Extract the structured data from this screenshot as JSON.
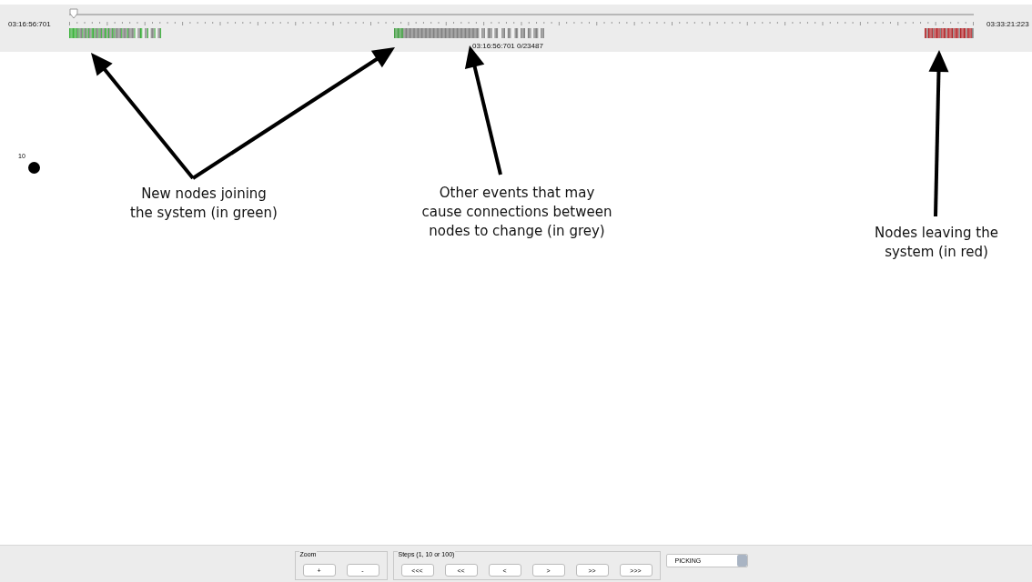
{
  "timeline": {
    "start_time": "03:16:56:701",
    "end_time": "03:33:21:223",
    "level": 0,
    "position_label": "03:16:56:701 0/23487"
  },
  "graph": {
    "nodes": [
      {
        "label": "10"
      }
    ]
  },
  "annotations": [
    {
      "lines": [
        "New nodes joining",
        "the system (in green)"
      ]
    },
    {
      "lines": [
        "Other events that may",
        "cause connections between",
        "nodes to change (in grey)"
      ]
    },
    {
      "lines": [
        "Nodes leaving the",
        "system (in red)"
      ]
    }
  ],
  "toolbar": {
    "zoom": {
      "title": "Zoom",
      "buttons": [
        "+",
        "-"
      ]
    },
    "steps": {
      "title": "Steps (1, 10 or 100)",
      "buttons": [
        "<<<",
        "<<",
        "<",
        ">",
        ">>",
        ">>>"
      ]
    },
    "mode": {
      "value": "PICKING"
    }
  }
}
